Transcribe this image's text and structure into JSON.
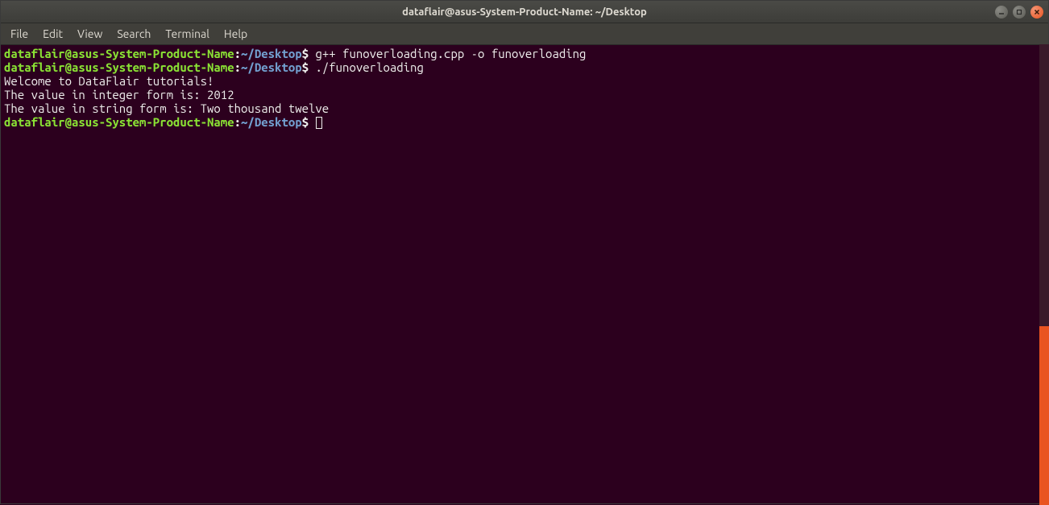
{
  "titlebar": {
    "title": "dataflair@asus-System-Product-Name: ~/Desktop"
  },
  "window_controls": {
    "minimize": "minimize",
    "maximize": "maximize",
    "close": "close"
  },
  "menubar": {
    "items": [
      "File",
      "Edit",
      "View",
      "Search",
      "Terminal",
      "Help"
    ]
  },
  "prompt": {
    "user_host": "dataflair@asus-System-Product-Name",
    "colon": ":",
    "path_prefix": "~/",
    "path_dir": "Desktop",
    "dollar": "$"
  },
  "lines": [
    {
      "type": "cmd",
      "text": " g++ funoverloading.cpp -o funoverloading"
    },
    {
      "type": "cmd",
      "text": " ./funoverloading"
    },
    {
      "type": "out",
      "text": "Welcome to DataFlair tutorials!"
    },
    {
      "type": "out",
      "text": ""
    },
    {
      "type": "out",
      "text": "The value in integer form is: 2012"
    },
    {
      "type": "out",
      "text": "The value in string form is: Two thousand twelve"
    },
    {
      "type": "prompt_only",
      "text": " "
    }
  ]
}
